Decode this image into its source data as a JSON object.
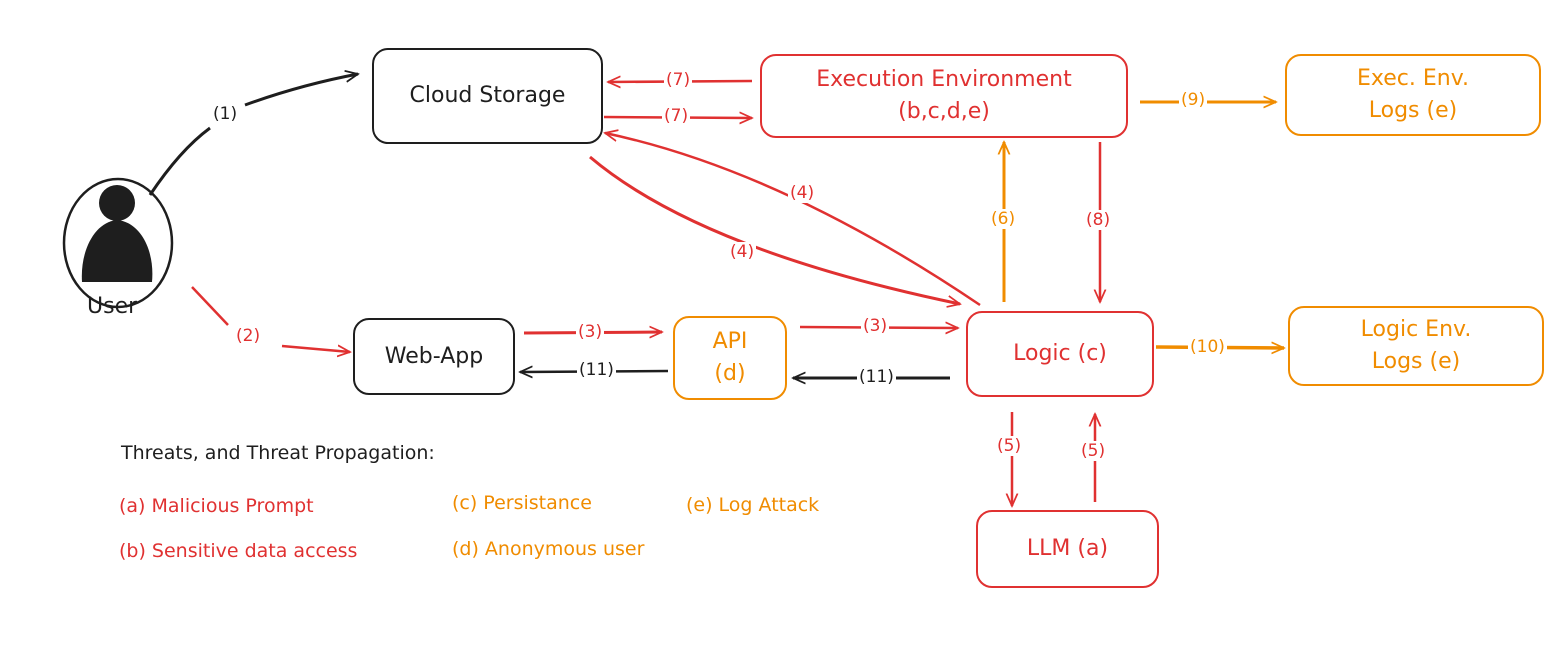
{
  "colors": {
    "black": "#1e1e1e",
    "red": "#e03131",
    "orange": "#f08c00"
  },
  "user": {
    "label": "User",
    "icon": "user-icon"
  },
  "nodes": {
    "cloud_storage": {
      "line1": "Cloud Storage",
      "line2": ""
    },
    "execution_env": {
      "line1": "Execution Environment",
      "line2": "(b,c,d,e)"
    },
    "exec_logs": {
      "line1": "Exec. Env.",
      "line2": "Logs (e)"
    },
    "web_app": {
      "line1": "Web-App",
      "line2": ""
    },
    "api": {
      "line1": "API",
      "line2": "(d)"
    },
    "logic": {
      "line1": "Logic (c)",
      "line2": ""
    },
    "logic_logs": {
      "line1": "Logic Env.",
      "line2": "Logs (e)"
    },
    "llm": {
      "line1": "LLM (a)",
      "line2": ""
    }
  },
  "edges": [
    {
      "id": "e1",
      "label": "(1)",
      "from": "User",
      "to": "Cloud Storage",
      "color": "black"
    },
    {
      "id": "e2",
      "label": "(2)",
      "from": "User",
      "to": "Web-App",
      "color": "red"
    },
    {
      "id": "e3a",
      "label": "(3)",
      "from": "Web-App",
      "to": "API",
      "color": "red"
    },
    {
      "id": "e3b",
      "label": "(3)",
      "from": "API",
      "to": "Logic (c)",
      "color": "red"
    },
    {
      "id": "e4a",
      "label": "(4)",
      "from": "Logic (c)",
      "to": "Cloud Storage",
      "color": "red"
    },
    {
      "id": "e4b",
      "label": "(4)",
      "from": "Cloud Storage",
      "to": "Logic (c)",
      "color": "red"
    },
    {
      "id": "e5a",
      "label": "(5)",
      "from": "Logic (c)",
      "to": "LLM (a)",
      "color": "red"
    },
    {
      "id": "e5b",
      "label": "(5)",
      "from": "LLM (a)",
      "to": "Logic (c)",
      "color": "red"
    },
    {
      "id": "e6",
      "label": "(6)",
      "from": "Logic (c)",
      "to": "Execution Environment",
      "color": "orange"
    },
    {
      "id": "e7a",
      "label": "(7)",
      "from": "Execution Environment",
      "to": "Cloud Storage",
      "color": "red"
    },
    {
      "id": "e7b",
      "label": "(7)",
      "from": "Cloud Storage",
      "to": "Execution Environment",
      "color": "red"
    },
    {
      "id": "e8",
      "label": "(8)",
      "from": "Execution Environment",
      "to": "Logic (c)",
      "color": "red"
    },
    {
      "id": "e9",
      "label": "(9)",
      "from": "Execution Environment",
      "to": "Exec. Env. Logs",
      "color": "orange"
    },
    {
      "id": "e10",
      "label": "(10)",
      "from": "Logic (c)",
      "to": "Logic Env. Logs",
      "color": "orange"
    },
    {
      "id": "e11a",
      "label": "(11)",
      "from": "Logic (c)",
      "to": "API",
      "color": "black"
    },
    {
      "id": "e11b",
      "label": "(11)",
      "from": "API",
      "to": "Web-App",
      "color": "black"
    }
  ],
  "legend": {
    "title": "Threats, and Threat Propagation:",
    "items": [
      {
        "text": "(a) Malicious Prompt",
        "color": "red"
      },
      {
        "text": "(b) Sensitive data access",
        "color": "red"
      },
      {
        "text": "(c) Persistance",
        "color": "orange"
      },
      {
        "text": "(d) Anonymous user",
        "color": "orange"
      },
      {
        "text": "(e) Log Attack",
        "color": "orange"
      }
    ]
  }
}
